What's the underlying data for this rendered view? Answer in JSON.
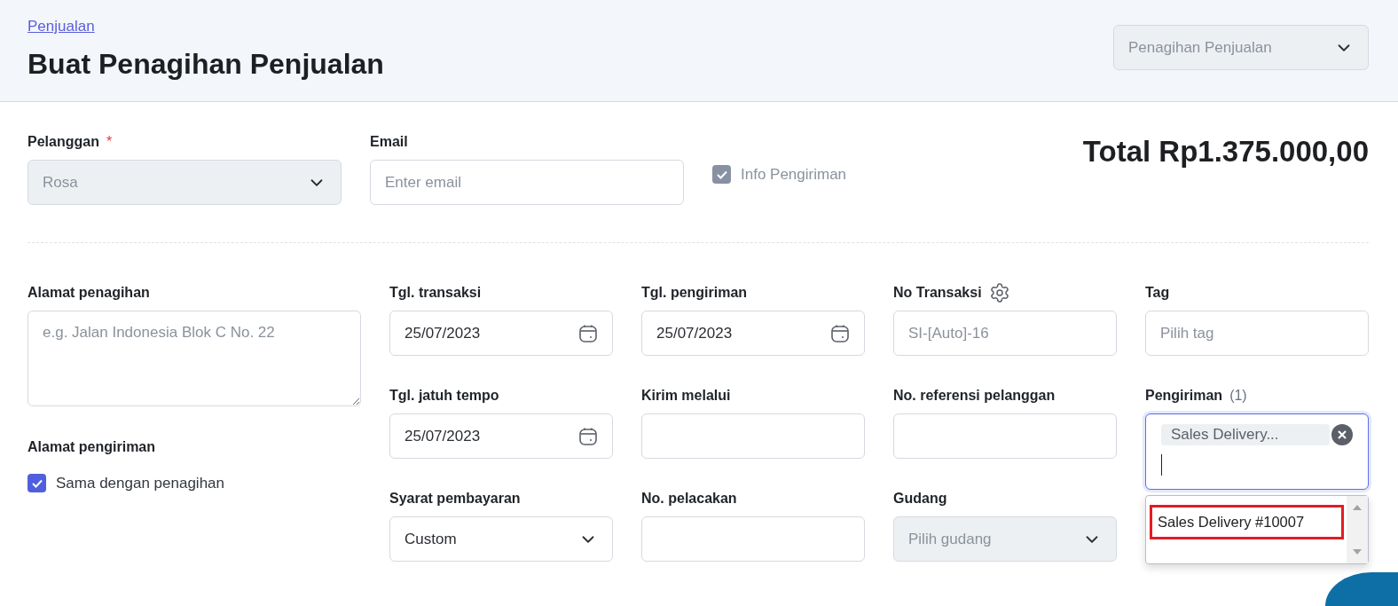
{
  "header": {
    "breadcrumb": "Penjualan",
    "title": "Buat Penagihan Penjualan",
    "doc_type_select": {
      "value": "Penagihan Penjualan",
      "disabled": true
    }
  },
  "customer": {
    "label": "Pelanggan",
    "required_mark": "*",
    "value": "Rosa",
    "disabled": true
  },
  "email": {
    "label": "Email",
    "placeholder": "Enter email"
  },
  "info_pengiriman": {
    "label": "Info Pengiriman",
    "checked": true,
    "disabled": true
  },
  "total": "Total Rp1.375.000,00",
  "billing_address": {
    "label": "Alamat penagihan",
    "placeholder": "e.g. Jalan Indonesia Blok C No. 22"
  },
  "shipping_address": {
    "label": "Alamat pengiriman",
    "same_as_billing": {
      "label": "Sama dengan penagihan",
      "checked": true
    }
  },
  "fields": [
    {
      "kind": "date",
      "label": "Tgl. transaksi",
      "value": "25/07/2023"
    },
    {
      "kind": "date",
      "label": "Tgl. pengiriman",
      "value": "25/07/2023"
    },
    {
      "kind": "text",
      "label": "No Transaksi",
      "settings": true,
      "placeholder": "SI-[Auto]-16"
    },
    {
      "kind": "text",
      "label": "Tag",
      "placeholder": "Pilih tag"
    },
    {
      "kind": "date",
      "label": "Tgl. jatuh tempo",
      "value": "25/07/2023"
    },
    {
      "kind": "text",
      "label": "Kirim melalui"
    },
    {
      "kind": "text",
      "label": "No. referensi pelanggan"
    },
    {
      "kind": "multiselect",
      "label": "Pengiriman",
      "count": "(1)",
      "focused": true,
      "tags": [
        "Sales Delivery..."
      ],
      "options": [
        {
          "label": "Sales Delivery #10007",
          "highlighted": true
        }
      ]
    },
    {
      "kind": "select",
      "label": "Syarat pembayaran",
      "value": "Custom",
      "disabled": false
    },
    {
      "kind": "text",
      "label": "No. pelacakan"
    },
    {
      "kind": "select",
      "label": "Gudang",
      "placeholder": "Pilih gudang",
      "disabled": true
    }
  ]
}
